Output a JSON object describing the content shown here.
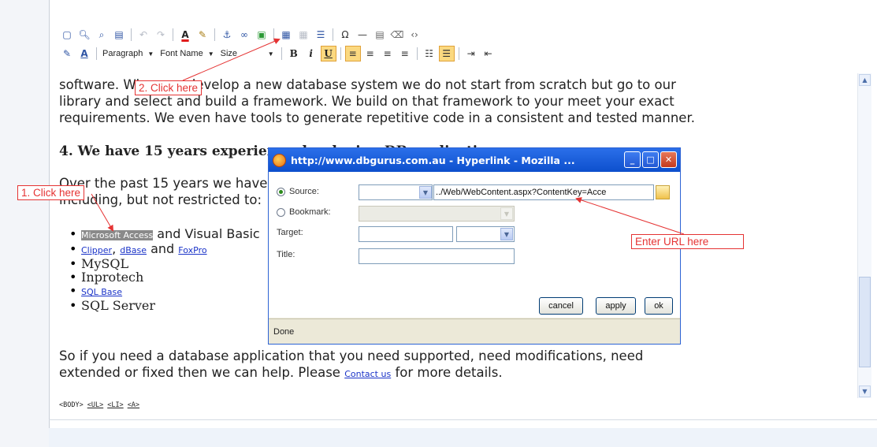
{
  "toolbar1": {
    "icons": [
      "source-icon",
      "preview-icon",
      "find-icon",
      "paste-word-icon",
      "undo-icon",
      "redo-icon",
      "text-color-icon",
      "highlight-icon",
      "anchor-icon",
      "hyperlink-icon",
      "image-icon",
      "table-icon",
      "table-props-icon",
      "form-icon",
      "special-char-icon",
      "horizontal-rule-icon",
      "select-all-icon",
      "clean-icon",
      "code-icon"
    ]
  },
  "toolbar2": {
    "paragraph_select": "Paragraph",
    "font_select": "Font Name",
    "size_select": "Size",
    "bold": "B",
    "italic": "i",
    "underline": "U"
  },
  "editor": {
    "para1_line1": "software. When we develop a new database system we do not start from scratch but go to our",
    "para1_line2": "library and select and build a framework. We build on that framework to your meet your exact",
    "para1_line3": "requirements. We even have tools to generate repetitive code in a consistent and tested manner.",
    "heading": "4. We have 15 years experience developing DB applications",
    "para2_line1": "Over the past 15 years we have developed applications in many different databases languages",
    "para2_line2": "including, but not restricted to:",
    "list": {
      "item1_link": "Microsoft Access",
      "item1_rest": " and Visual Basic",
      "item2_a": "Clipper",
      "item2_sep": ", ",
      "item2_b": "dBase",
      "item2_and": " and ",
      "item2_c": "FoxPro",
      "item3": "MySQL",
      "item4": "Inprotech",
      "item5": "SQL Base",
      "item6": "SQL Server"
    },
    "para3_line1": "So if you need a database application that you need supported, need modifications, need",
    "para3_line2_a": "extended or fixed then we can help. Please ",
    "para3_link": "Contact us",
    "para3_line2_b": " for more details."
  },
  "status_path": [
    "<BODY>",
    "<UL>",
    "<LI>",
    "<A>"
  ],
  "dialog": {
    "title": "http://www.dbgurus.com.au - Hyperlink - Mozilla ...",
    "source_label": "Source:",
    "source_value": "../Web/WebContent.aspx?ContentKey=Acce",
    "bookmark_label": "Bookmark:",
    "target_label": "Target:",
    "title_label": "Title:",
    "cancel": "cancel",
    "apply": "apply",
    "ok": "ok",
    "status": "Done"
  },
  "annotations": {
    "click1": "1. Click here",
    "click2": "2. Click here",
    "enter_url": "Enter URL here",
    "color": "#e53333"
  }
}
